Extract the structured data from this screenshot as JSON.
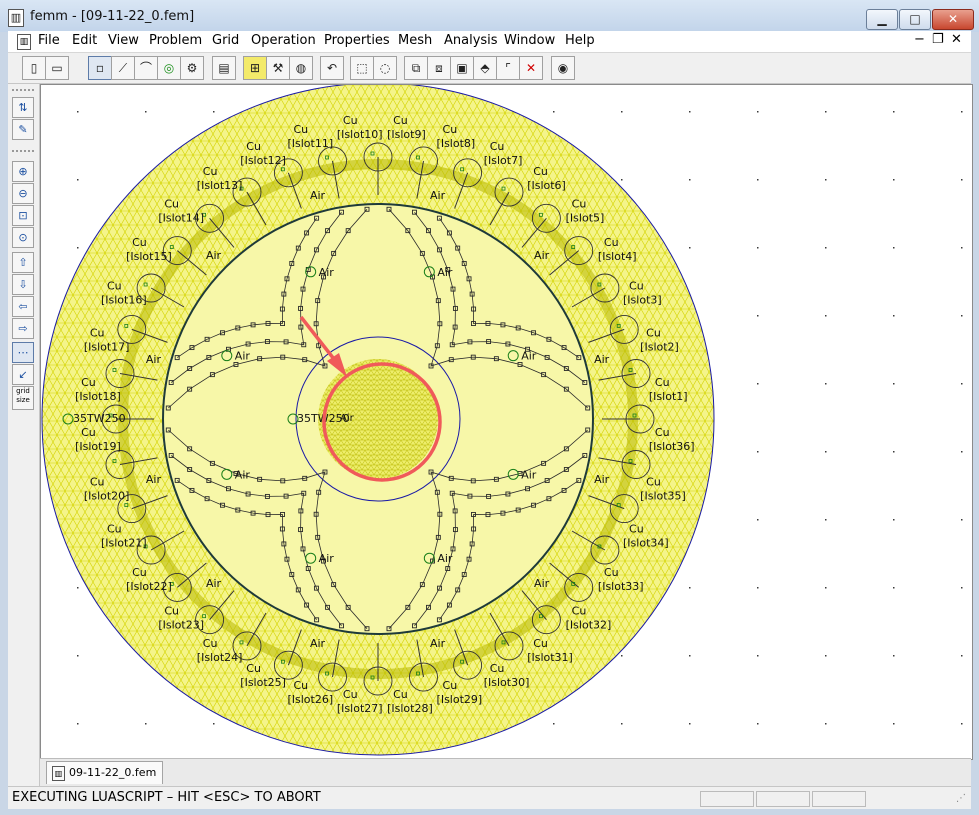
{
  "window": {
    "app_icon": "femm-app-icon",
    "title": "femm - [09-11-22_0.fem]",
    "minimize": "▁",
    "maximize": "□",
    "close": "✕"
  },
  "menu": {
    "items": [
      "File",
      "Edit",
      "View",
      "Problem",
      "Grid",
      "Operation",
      "Properties",
      "Mesh",
      "Analysis",
      "Window",
      "Help"
    ],
    "mdi_minimize": "−",
    "mdi_restore": "❐",
    "mdi_close": "✕"
  },
  "toolbar": {
    "icons": [
      "new-file-icon",
      "open-file-icon",
      "node-icon",
      "segment-icon",
      "arc-icon",
      "block-label-icon",
      "group-icon",
      "properties-icon",
      "select-window-icon",
      "mesh-icon",
      "analyze-icon",
      "undo-icon",
      "box-select-icon",
      "circle-select-icon",
      "copy-icon",
      "move-icon",
      "scale-icon",
      "mirror-icon",
      "fillet-icon",
      "delete-icon",
      "view-results-icon"
    ]
  },
  "left_toolbar": {
    "icons": [
      "sort-icon",
      "edit-pencil-icon",
      "zoom-in-icon",
      "zoom-out-icon",
      "zoom-window-icon",
      "zoom-natural-icon",
      "pan-up-icon",
      "pan-down-icon",
      "pan-left-icon",
      "pan-right-icon",
      "show-grid-icon",
      "snap-grid-icon",
      "grid-size-icon"
    ],
    "grid_size_label": "grid size"
  },
  "drawing": {
    "colors": {
      "mesh": "#d4d400",
      "mesh_fill": "#f4f48a",
      "boundary": "#1a1aa6",
      "nodes": "#2a2a2a",
      "labels": "#111111",
      "annotation": "#f05a5a",
      "grid_dots": "#3a3a3a"
    },
    "block_labels": {
      "outer_material": "35TW250",
      "inner_material": "35TW250",
      "gap": "Air",
      "conductor_material": "Cu",
      "slot_prefix": "Islot",
      "slot_count": 36,
      "center_label": "Air"
    }
  },
  "document_tab": {
    "icon": "document-icon",
    "label": "09-11-22_0.fem"
  },
  "status": {
    "text": "EXECUTING LUASCRIPT – HIT <ESC> TO ABORT"
  }
}
